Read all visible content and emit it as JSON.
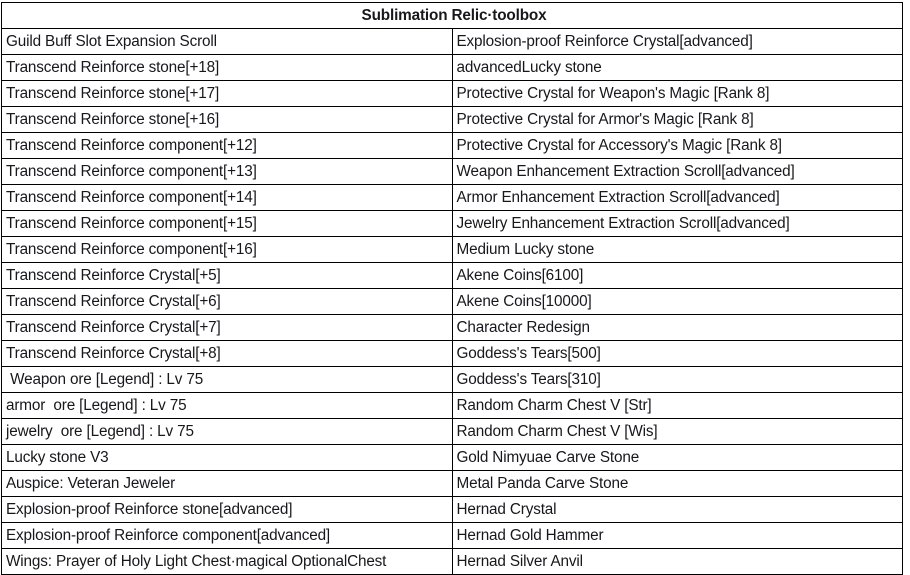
{
  "table": {
    "title": "Sublimation Relic·toolbox",
    "title_bg": "#ffff00",
    "highlight_bg": "#e4b8e8",
    "border_color": "#000000",
    "text_color": "#17171c",
    "columns": 2,
    "rows": [
      {
        "left": "Guild Buff Slot Expansion Scroll",
        "right": "Explosion-proof Reinforce Crystal[advanced]",
        "left_highlight": false,
        "right_highlight": false
      },
      {
        "left": "Transcend Reinforce stone[+18]",
        "right": "advancedLucky stone",
        "left_highlight": false,
        "right_highlight": false
      },
      {
        "left": "Transcend Reinforce stone[+17]",
        "right": "Protective Crystal for Weapon's Magic [Rank 8]",
        "left_highlight": false,
        "right_highlight": false
      },
      {
        "left": "Transcend Reinforce stone[+16]",
        "right": "Protective Crystal for Armor's Magic [Rank 8]",
        "left_highlight": false,
        "right_highlight": false
      },
      {
        "left": "Transcend Reinforce component[+12]",
        "right": "Protective Crystal for Accessory's Magic [Rank 8]",
        "left_highlight": false,
        "right_highlight": false
      },
      {
        "left": "Transcend Reinforce component[+13]",
        "right": "Weapon Enhancement Extraction Scroll[advanced]",
        "left_highlight": false,
        "right_highlight": false
      },
      {
        "left": "Transcend Reinforce component[+14]",
        "right": "Armor Enhancement Extraction Scroll[advanced]",
        "left_highlight": false,
        "right_highlight": false
      },
      {
        "left": "Transcend Reinforce component[+15]",
        "right": "Jewelry Enhancement Extraction Scroll[advanced]",
        "left_highlight": false,
        "right_highlight": false
      },
      {
        "left": "Transcend Reinforce component[+16]",
        "right": "Medium Lucky stone",
        "left_highlight": false,
        "right_highlight": false
      },
      {
        "left": "Transcend Reinforce Crystal[+5]",
        "right": "Akene Coins[6100]",
        "left_highlight": false,
        "right_highlight": false
      },
      {
        "left": "Transcend Reinforce Crystal[+6]",
        "right": "Akene Coins[10000]",
        "left_highlight": false,
        "right_highlight": false
      },
      {
        "left": "Transcend Reinforce Crystal[+7]",
        "right": "Character Redesign",
        "left_highlight": false,
        "right_highlight": false
      },
      {
        "left": "Transcend Reinforce Crystal[+8]",
        "right": "Goddess's Tears[500]",
        "left_highlight": false,
        "right_highlight": false
      },
      {
        "left": " Weapon ore [Legend] : Lv 75",
        "right": "Goddess's Tears[310]",
        "left_highlight": false,
        "right_highlight": false
      },
      {
        "left": "armor  ore [Legend] : Lv 75",
        "right": "Random Charm Chest V [Str]",
        "left_highlight": false,
        "right_highlight": false
      },
      {
        "left": "jewelry  ore [Legend] : Lv 75",
        "right": "Random Charm Chest V [Wis]",
        "left_highlight": false,
        "right_highlight": false
      },
      {
        "left": "Lucky stone V3",
        "right": "Gold Nimyuae Carve Stone",
        "left_highlight": false,
        "right_highlight": false
      },
      {
        "left": "Auspice: Veteran Jeweler",
        "right": "Metal Panda Carve Stone",
        "left_highlight": false,
        "right_highlight": false
      },
      {
        "left": "Explosion-proof Reinforce stone[advanced]",
        "right": "Hernad Crystal",
        "left_highlight": false,
        "right_highlight": false
      },
      {
        "left": "Explosion-proof Reinforce component[advanced]",
        "right": "Hernad Gold Hammer",
        "left_highlight": false,
        "right_highlight": false
      },
      {
        "left": "Wings: Prayer of Holy Light Chest·magical OptionalChest",
        "right": "Hernad Silver Anvil",
        "left_highlight": true,
        "right_highlight": false
      }
    ]
  }
}
